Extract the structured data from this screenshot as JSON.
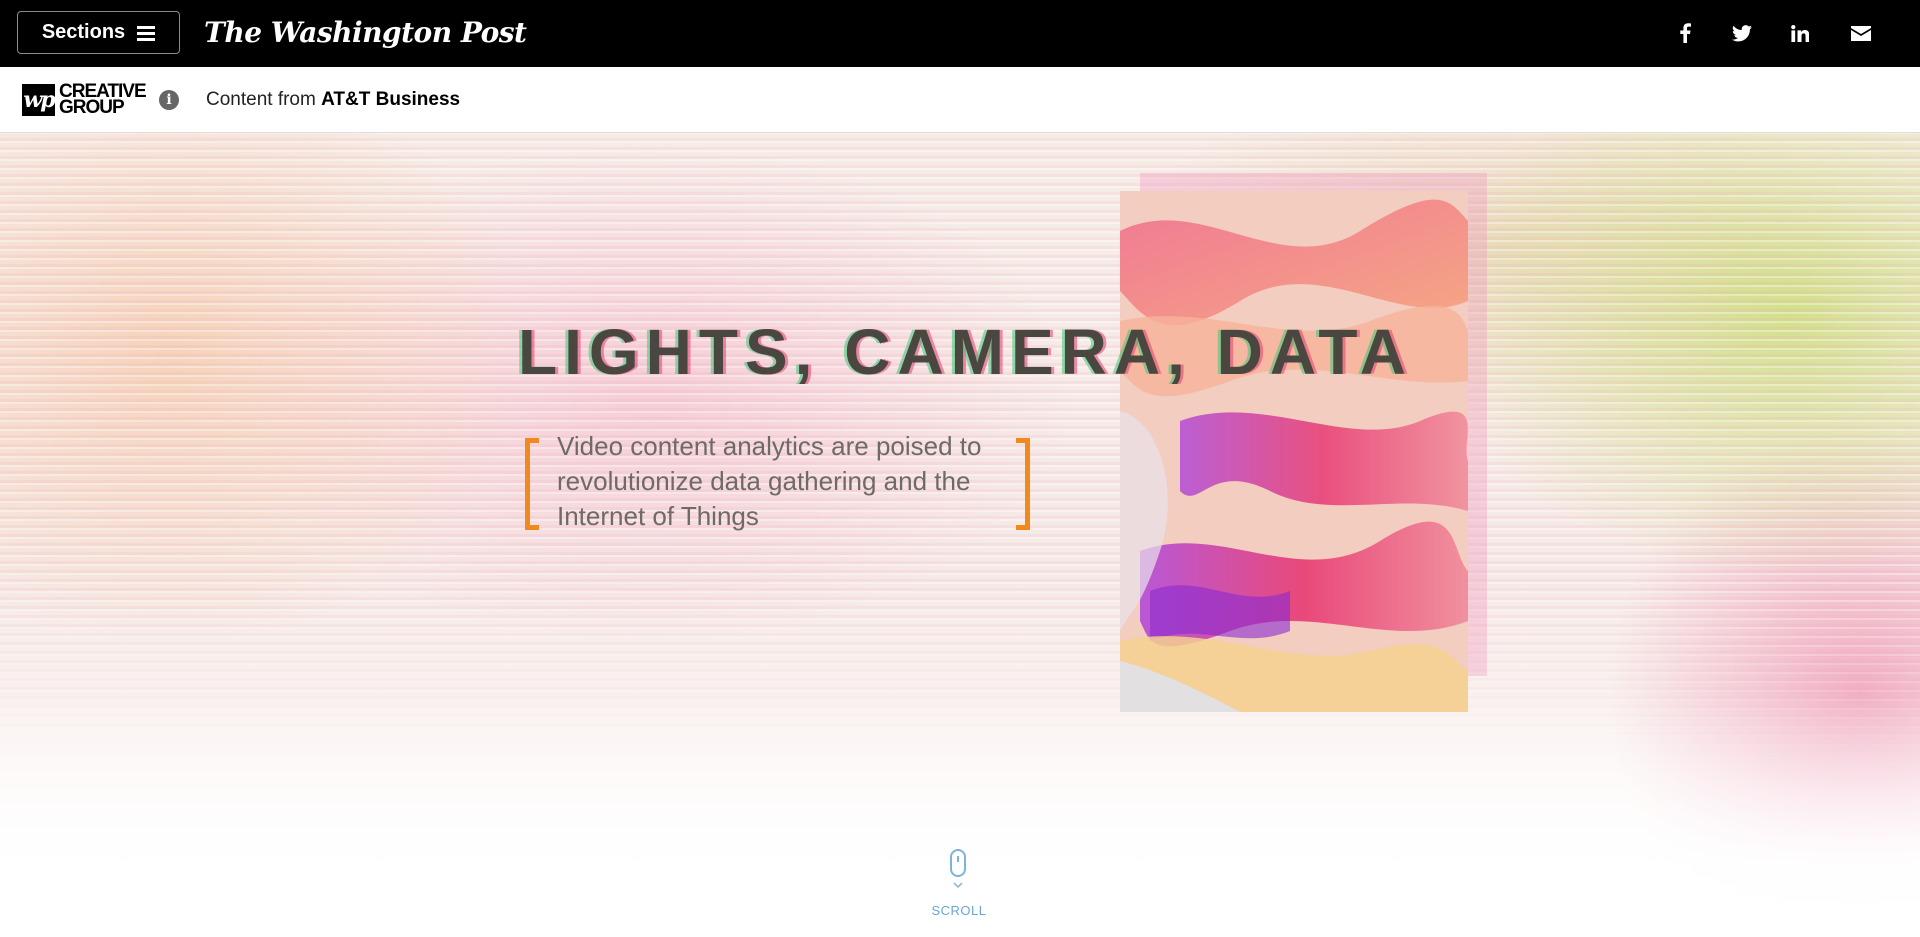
{
  "topbar": {
    "sections_label": "Sections",
    "logo_text": "The Washington Post",
    "social": [
      "facebook-icon",
      "twitter-icon",
      "linkedin-icon",
      "email-icon"
    ]
  },
  "sponsor": {
    "brand_mark": "wp",
    "brand_text": "CREATIVE GROUP",
    "content_from": "Content from",
    "sponsor_name": "AT&T Business"
  },
  "hero": {
    "title": "LIGHTS, CAMERA, DATA",
    "subtitle": "Video content analytics are poised to revolutionize data gathering and the Internet of Things"
  },
  "scroll": {
    "label": "SCROLL"
  },
  "colors": {
    "accent_bracket": "#f08a1c",
    "title": "#4a4640",
    "scroll": "#6aa6d4"
  }
}
